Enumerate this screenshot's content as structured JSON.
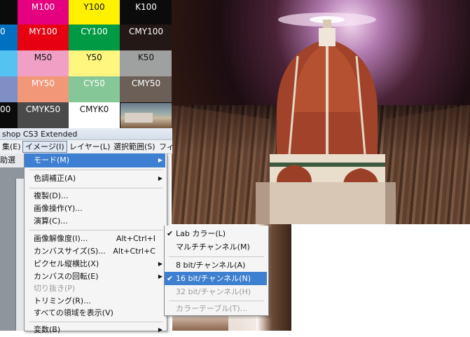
{
  "swatches": [
    {
      "label": "M100",
      "bg": "#e5007f",
      "fg": "#ffffff"
    },
    {
      "label": "Y100",
      "bg": "#fff100",
      "fg": "#111111"
    },
    {
      "label": "K100",
      "bg": "#0b0b0b",
      "fg": "#ffffff"
    },
    {
      "label": "0",
      "bg": "#0070c0",
      "fg": "#ffffff"
    },
    {
      "label": "MY100",
      "bg": "#e60012",
      "fg": "#ffffff"
    },
    {
      "label": "CY100",
      "bg": "#009944",
      "fg": "#ffffff"
    },
    {
      "label": "CMY100",
      "bg": "#231815",
      "fg": "#ffffff"
    },
    {
      "label": "",
      "bg": "#54c3f1",
      "fg": "#111111"
    },
    {
      "label": "M50",
      "bg": "#f29fc5",
      "fg": "#111111"
    },
    {
      "label": "Y50",
      "bg": "#fff67f",
      "fg": "#111111"
    },
    {
      "label": "K50",
      "bg": "#9fa0a0",
      "fg": "#111111"
    },
    {
      "label": "",
      "bg": "#7f8fc6",
      "fg": "#ffffff"
    },
    {
      "label": "MY50",
      "bg": "#f39779",
      "fg": "#ffffff"
    },
    {
      "label": "CY50",
      "bg": "#86c797",
      "fg": "#ffffff"
    },
    {
      "label": "CMY50",
      "bg": "#6b5f57",
      "fg": "#ffffff"
    },
    {
      "label": "00",
      "bg": "#0b0b0b",
      "fg": "#ffffff"
    },
    {
      "label": "CMYK50",
      "bg": "#4a4a4a",
      "fg": "#ffffff"
    },
    {
      "label": "CMYK0",
      "bg": "#ffffff",
      "fg": "#111111"
    }
  ],
  "window": {
    "title": "shop CS3 Extended",
    "menubar": [
      "集(E)",
      "イメージ(I)",
      "レイヤー(L)",
      "選択範囲(S)",
      "フィ"
    ],
    "options_label": "助選択："
  },
  "image_menu": {
    "items": [
      {
        "label": "モード(M)",
        "shortcut": "",
        "submenu": true,
        "state": "highlighted"
      },
      {
        "label": "色調補正(A)",
        "shortcut": "",
        "submenu": true,
        "state": "normal"
      },
      {
        "label": "複製(D)...",
        "shortcut": "",
        "submenu": false,
        "state": "normal"
      },
      {
        "label": "画像操作(Y)...",
        "shortcut": "",
        "submenu": false,
        "state": "normal"
      },
      {
        "label": "演算(C)...",
        "shortcut": "",
        "submenu": false,
        "state": "normal"
      },
      {
        "label": "画像解像度(I)...",
        "shortcut": "Alt+Ctrl+I",
        "submenu": false,
        "state": "normal"
      },
      {
        "label": "カンバスサイズ(S)...",
        "shortcut": "Alt+Ctrl+C",
        "submenu": false,
        "state": "normal"
      },
      {
        "label": "ピクセル縦横比(X)",
        "shortcut": "",
        "submenu": true,
        "state": "normal"
      },
      {
        "label": "カンバスの回転(E)",
        "shortcut": "",
        "submenu": true,
        "state": "normal"
      },
      {
        "label": "切り抜き(P)",
        "shortcut": "",
        "submenu": false,
        "state": "disabled"
      },
      {
        "label": "トリミング(R)...",
        "shortcut": "",
        "submenu": false,
        "state": "normal"
      },
      {
        "label": "すべての領域を表示(V)",
        "shortcut": "",
        "submenu": false,
        "state": "normal"
      },
      {
        "label": "変数(B)",
        "shortcut": "",
        "submenu": true,
        "state": "normal"
      }
    ]
  },
  "mode_submenu": {
    "items": [
      {
        "label": "Lab カラー(L)",
        "checked": true,
        "state": "normal"
      },
      {
        "label": "マルチチャンネル(M)",
        "checked": false,
        "state": "normal"
      },
      {
        "label": "8 bit/チャンネル(A)",
        "checked": false,
        "state": "normal"
      },
      {
        "label": "16 bit/チャンネル(N)",
        "checked": true,
        "state": "highlighted"
      },
      {
        "label": "32 bit/チャンネル(H)",
        "checked": false,
        "state": "disabled"
      },
      {
        "label": "カラーテーブル(T)...",
        "checked": false,
        "state": "disabled"
      }
    ]
  },
  "icons": {
    "submenu_arrow": "triangle-right-icon",
    "check": "check-icon"
  }
}
